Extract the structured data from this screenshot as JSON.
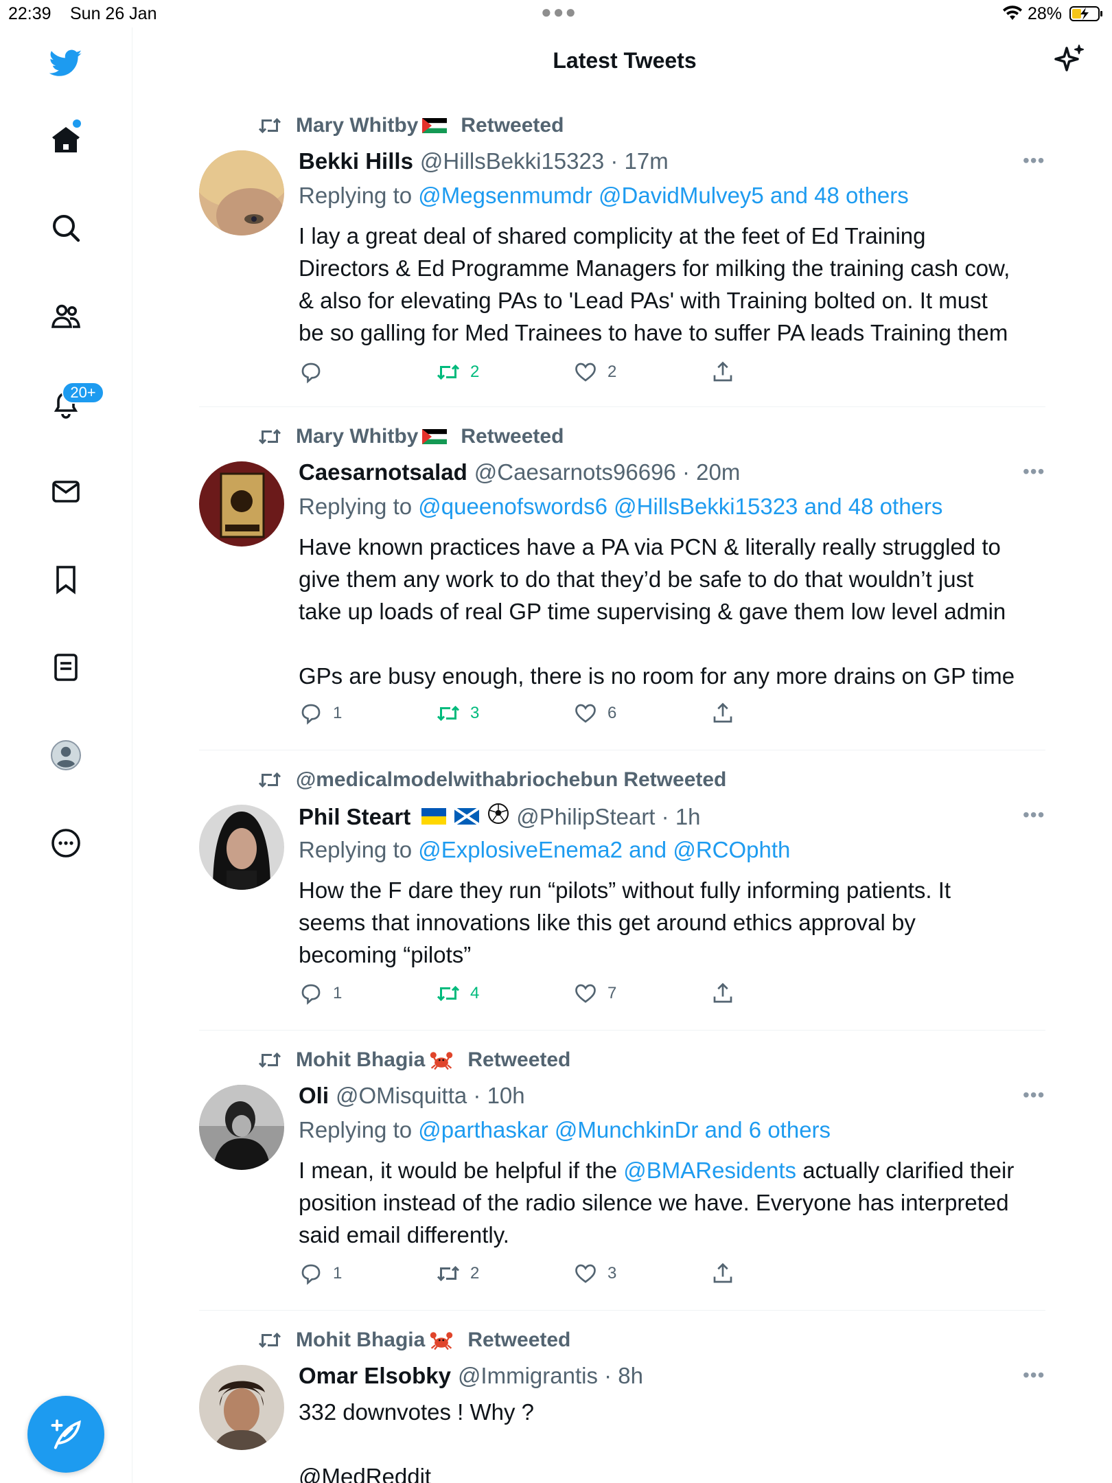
{
  "status": {
    "time": "22:39",
    "date": "Sun 26 Jan",
    "battery": "28%"
  },
  "header": {
    "title": "Latest Tweets"
  },
  "sidebar": {
    "notifications_badge": "20+"
  },
  "tweets": [
    {
      "retweeted_by": "Mary Whitby",
      "retweeted_by_flag": "palestine-flag",
      "retweeted_label": "Retweeted",
      "name": "Bekki Hills",
      "handle": "@HillsBekki15323",
      "time": "17m",
      "replying_prefix": "Replying to",
      "replying_to": "@Megsenmumdr @DavidMulvey5 and 48 others",
      "body": "I lay a great deal of shared complicity at the feet of Ed Training\nDirectors & Ed Programme Managers for milking the training cash cow,\n& also for elevating PAs to 'Lead PAs' with Training bolted on. It must\nbe so galling for Med Trainees to have to suffer PA leads Training them",
      "replies": "",
      "retweets": "2",
      "likes": "2",
      "retweeted": true
    },
    {
      "retweeted_by": "Mary Whitby",
      "retweeted_by_flag": "palestine-flag",
      "retweeted_label": "Retweeted",
      "name": "Caesarnotsalad",
      "handle": "@Caesarnots96696",
      "time": "20m",
      "replying_prefix": "Replying to",
      "replying_to": "@queenofswords6 @HillsBekki15323 and 48 others",
      "body": "Have known practices have a PA via PCN & literally really struggled to\ngive them any work to do that they’d be safe to do that wouldn’t just\ntake up loads of real GP time supervising & gave them low level admin\n\nGPs are busy enough, there is no room for any more drains on GP time",
      "replies": "1",
      "retweets": "3",
      "likes": "6",
      "retweeted": true
    },
    {
      "retweeted_by": "@medicalmodelwithabriochebun",
      "retweeted_by_flag": "",
      "retweeted_label": "Retweeted",
      "name": "Phil Steart",
      "handle": "@PhilipSteart",
      "time": "1h",
      "replying_prefix": "Replying to",
      "replying_to": "@ExplosiveEnema2 and @RCOphth",
      "body": "How the F dare they run “pilots” without fully informing patients. It\nseems that innovations like this get around ethics approval by\nbecoming “pilots”",
      "replies": "1",
      "retweets": "4",
      "likes": "7",
      "retweeted": true
    },
    {
      "retweeted_by": "Mohit Bhagia",
      "retweeted_by_flag": "crab-emoji",
      "retweeted_label": "Retweeted",
      "name": "Oli",
      "handle": "@OMisquitta",
      "time": "10h",
      "replying_prefix": "Replying to",
      "replying_to": "@parthaskar @MunchkinDr and 6 others",
      "body_pre": "I mean, it would be helpful if the ",
      "body_link": "@BMAResidents",
      "body_post": " actually clarified their\nposition instead of the radio silence we have. Everyone has interpreted\nsaid email differently.",
      "replies": "1",
      "retweets": "2",
      "likes": "3",
      "retweeted": false
    },
    {
      "retweeted_by": "Mohit Bhagia",
      "retweeted_by_flag": "crab-emoji",
      "retweeted_label": "Retweeted",
      "name": "Omar Elsobky",
      "handle": "@Immigrantis",
      "time": "8h",
      "body": "332 downvotes ! Why ?",
      "body_link2": "@MedReddit"
    }
  ],
  "colors": {
    "accent": "#1d9bf0",
    "retweet_green": "#00ba7c",
    "muted": "#536471"
  }
}
